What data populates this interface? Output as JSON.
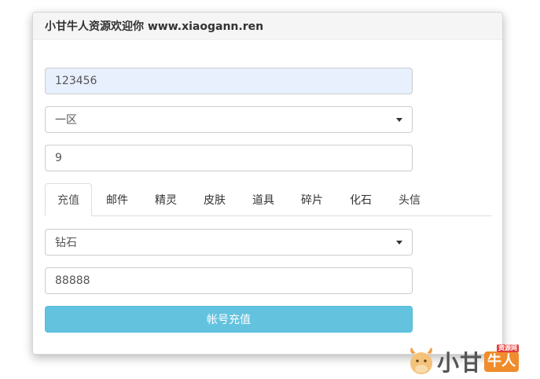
{
  "panel": {
    "title": "小甘牛人资源欢迎你 www.xiaogann.ren"
  },
  "form": {
    "account_value": "123456",
    "server_select": "一区",
    "quantity_value": "9",
    "item_select": "钻石",
    "amount_value": "88888",
    "submit_label": "帐号充值"
  },
  "tabs": [
    {
      "label": "充值",
      "active": true
    },
    {
      "label": "邮件"
    },
    {
      "label": "精灵"
    },
    {
      "label": "皮肤"
    },
    {
      "label": "道具"
    },
    {
      "label": "碎片"
    },
    {
      "label": "化石"
    },
    {
      "label": "头信"
    }
  ],
  "watermark": {
    "text": "小甘",
    "badge": "牛人",
    "badge_small": "资源网"
  },
  "colors": {
    "button": "#5bc0de",
    "filled_input": "#e8f0fe",
    "badge": "#f08c2c"
  }
}
